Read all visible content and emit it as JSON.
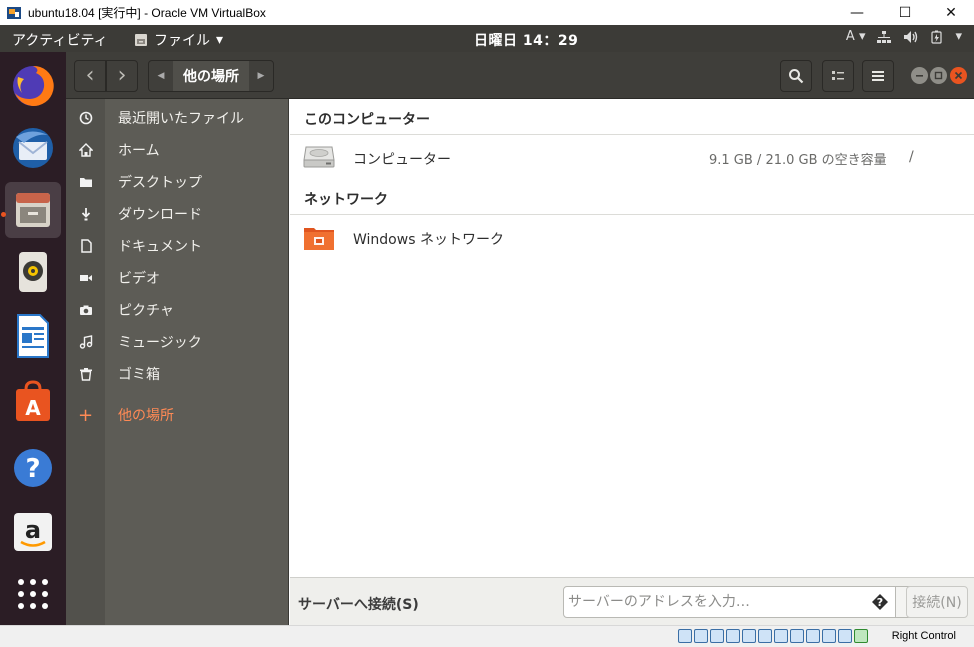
{
  "vbox": {
    "title": "ubuntu18.04 [実行中] - Oracle VM VirtualBox",
    "minimize_glyph": "—",
    "maximize_glyph": "☐",
    "close_glyph": "✕",
    "host_key": "Right Control"
  },
  "topbar": {
    "activities": "アクティビティ",
    "app_menu": "ファイル",
    "app_menu_arrow": "▾",
    "clock": "日曜日 14：29",
    "input_method": "A",
    "input_arrow": "▾"
  },
  "dock": {
    "items": [
      "firefox-icon",
      "thunderbird-icon",
      "files-icon",
      "rhythmbox-icon",
      "libreoffice-writer-icon",
      "ubuntu-software-icon",
      "help-icon",
      "amazon-icon",
      "show-applications-icon"
    ]
  },
  "header": {
    "back": "‹",
    "forward": "›",
    "path_left_arrow": "◀",
    "path_current": "他の場所",
    "path_right_arrow": "▶"
  },
  "sidebar": {
    "items": [
      {
        "label": "最近開いたファイル",
        "icon": "clock-icon"
      },
      {
        "label": "ホーム",
        "icon": "home-icon"
      },
      {
        "label": "デスクトップ",
        "icon": "folder-icon"
      },
      {
        "label": "ダウンロード",
        "icon": "download-icon"
      },
      {
        "label": "ドキュメント",
        "icon": "document-icon"
      },
      {
        "label": "ビデオ",
        "icon": "video-icon"
      },
      {
        "label": "ピクチャ",
        "icon": "camera-icon"
      },
      {
        "label": "ミュージック",
        "icon": "music-icon"
      },
      {
        "label": "ゴミ箱",
        "icon": "trash-icon"
      }
    ],
    "other_locations": {
      "label": "他の場所",
      "icon": "plus-icon",
      "glyph": "+"
    }
  },
  "main": {
    "computer_section": "このコンピューター",
    "computer_label": "コンピューター",
    "computer_space": "9.1 GB / 21.0 GB の空き容量",
    "computer_path": "/",
    "network_section": "ネットワーク",
    "windows_network": "Windows ネットワーク"
  },
  "bottom": {
    "connect_label": "サーバーへ接続(S)",
    "server_placeholder": "サーバーのアドレスを入力…",
    "server_value": "",
    "connect_button": "接続(N)"
  },
  "colors": {
    "accent": "#e95420",
    "topbar": "#3c3b37",
    "dock": "#2b1d25",
    "sidebar": "#5d5c56"
  }
}
